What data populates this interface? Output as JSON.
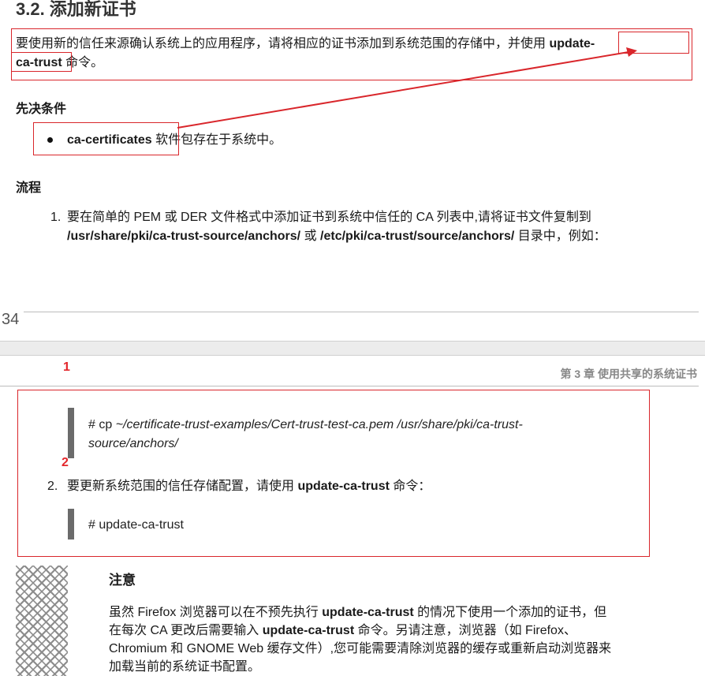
{
  "page1": {
    "section_title": "3.2. 添加新证书",
    "intro_part1": "要使用新的信任来源确认系统上的应用程序，请将相应的证书添加到系统范围的存储中，并使用",
    "intro_cmd_part1": "update-",
    "intro_cmd_part2": "ca-trust",
    "intro_part2": "命令。",
    "prereq_heading": "先决条件",
    "prereq_pkg": "ca-certificates",
    "prereq_text": "软件包存在于系统中。",
    "procedure_heading": "流程",
    "step1_num": "1.",
    "step1_text": "要在简单的 PEM 或 DER 文件格式中添加证书到系统中信任的 CA 列表中,请将证书文件复制到",
    "step1_path1": "/usr/share/pki/ca-trust-source/anchors/",
    "step1_or": "或",
    "step1_path2": "/etc/pki/ca-trust/source/anchors/",
    "step1_suffix": "目录中，例如：",
    "page_number": "34"
  },
  "page2": {
    "running_head": "第 3 章 使用共享的系统证书",
    "marker1": "1",
    "marker2": "2",
    "code1_prompt": "# cp ",
    "code1_line1": "~/certificate-trust-examples/Cert-trust-test-ca.pem /usr/share/pki/ca-trust-",
    "code1_line2": "source/anchors/",
    "step2_num": "2.",
    "step2_text": "要更新系统范围的信任存储配置，请使用",
    "step2_cmd": "update-ca-trust",
    "step2_suffix": "命令：",
    "code2": "# update-ca-trust",
    "note_title": "注意",
    "note_l1_a": "虽然 Firefox 浏览器可以在不预先执行",
    "note_l1_cmd": "update-ca-trust",
    "note_l1_b": "的情况下使用一个添加的证书，但",
    "note_l2_a": "在每次 CA 更改后需要输入",
    "note_l2_cmd": "update-ca-trust",
    "note_l2_b": "命令。另请注意，浏览器（如 Firefox、",
    "note_l3": "Chromium 和 GNOME Web 缓存文件）,您可能需要清除浏览器的缓存或重新启动浏览器来",
    "note_l4": "加载当前的系统证书配置。"
  },
  "colors": {
    "annotation": "#d9262b",
    "marker": "#e3262b",
    "code_bar": "#6b6b6b"
  },
  "icons": [
    "note-pattern-icon"
  ]
}
